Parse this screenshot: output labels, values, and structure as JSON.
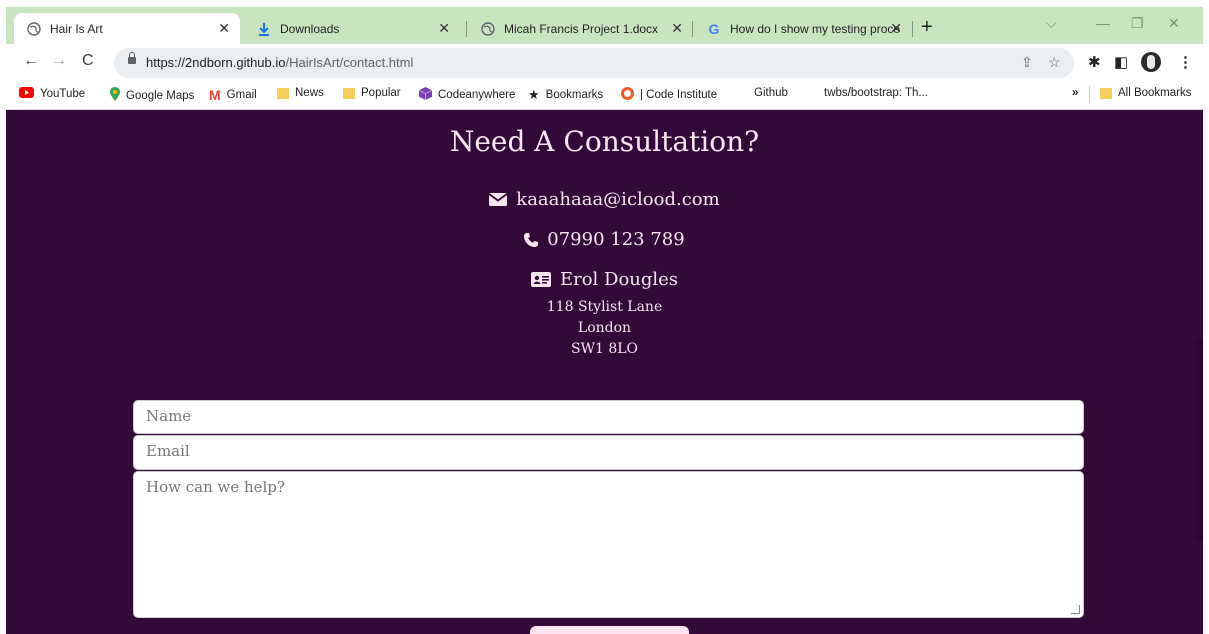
{
  "browser": {
    "tabs": [
      {
        "title": "Hair Is Art",
        "active": true
      },
      {
        "title": "Downloads",
        "active": false
      },
      {
        "title": "Micah Francis Project 1.docx",
        "active": false
      },
      {
        "title": "How do I show my testing proce",
        "active": false
      }
    ],
    "url_host": "https://2ndborn.github.io",
    "url_path": "/HairIsArt/contact.html",
    "bookmarks": [
      {
        "label": "YouTube",
        "icon": "youtube-icon"
      },
      {
        "label": "Google Maps",
        "icon": "maps-pin-icon"
      },
      {
        "label": "Gmail",
        "icon": "gmail-icon"
      },
      {
        "label": "News",
        "icon": "folder-icon"
      },
      {
        "label": "Popular",
        "icon": "folder-icon"
      },
      {
        "label": "Codeanywhere",
        "icon": "cube-icon"
      },
      {
        "label": "Bookmarks",
        "icon": "star-icon"
      },
      {
        "label": "| Code Institute",
        "icon": "ring-icon"
      },
      {
        "label": "Github",
        "icon": ""
      },
      {
        "label": "twbs/bootstrap: Th...",
        "icon": ""
      }
    ],
    "bookmarks_overflow": "»",
    "all_bookmarks": "All Bookmarks"
  },
  "page": {
    "heading": "Need A Consultation?",
    "email": "kaaahaaa@iclood.com",
    "phone": "07990 123 789",
    "name": "Erol Dougles",
    "address": [
      "118 Stylist Lane",
      "London",
      "SW1 8LO"
    ],
    "form": {
      "name_placeholder": "Name",
      "email_placeholder": "Email",
      "message_placeholder": "How can we help?"
    }
  },
  "colors": {
    "page_bg": "#35083a",
    "tab_strip": "#c9e5c0",
    "text_light": "#f5e6f0"
  }
}
